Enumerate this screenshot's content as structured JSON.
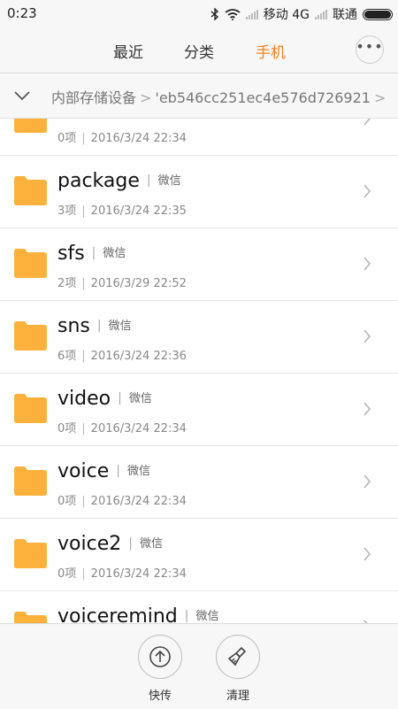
{
  "status_bar": {
    "time": "0:23",
    "carrier1": "移动 4G",
    "carrier2": "联通"
  },
  "tabs": [
    {
      "label": "最近",
      "active": false
    },
    {
      "label": "分类",
      "active": false
    },
    {
      "label": "手机",
      "active": true
    }
  ],
  "more_label": "•••",
  "breadcrumb": {
    "root": "内部存储设备",
    "current": "'eb546cc251ec4e576d726921"
  },
  "source_label": "微信",
  "files": [
    {
      "name": "",
      "count": "0项",
      "date": "2016/3/24 22:34"
    },
    {
      "name": "package",
      "count": "3项",
      "date": "2016/3/24 22:35"
    },
    {
      "name": "sfs",
      "count": "2项",
      "date": "2016/3/29 22:52"
    },
    {
      "name": "sns",
      "count": "6项",
      "date": "2016/3/24 22:36"
    },
    {
      "name": "video",
      "count": "0项",
      "date": "2016/3/24 22:34"
    },
    {
      "name": "voice",
      "count": "0项",
      "date": "2016/3/24 22:34"
    },
    {
      "name": "voice2",
      "count": "0项",
      "date": "2016/3/24 22:34"
    },
    {
      "name": "voiceremind",
      "count": "",
      "date": ""
    }
  ],
  "bottom": {
    "share_label": "快传",
    "clean_label": "清理"
  },
  "colors": {
    "accent": "#f7801d",
    "folder": "#fbb13c"
  }
}
